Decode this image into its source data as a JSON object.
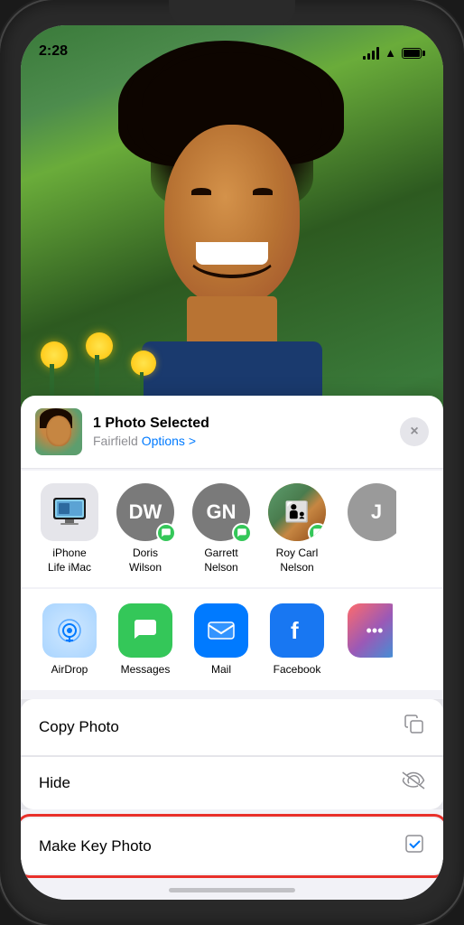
{
  "status": {
    "time": "2:28",
    "location_active": true
  },
  "header": {
    "photo_count": "1 Photo Selected",
    "location": "Fairfield",
    "options_label": "Options >",
    "close_btn": "×"
  },
  "contacts": [
    {
      "id": "imac",
      "name": "iPhone\nLife iMac",
      "type": "device",
      "initials": ""
    },
    {
      "id": "doris",
      "name": "Doris\nWilson",
      "type": "person",
      "initials": "DW",
      "color": "#8e8e93"
    },
    {
      "id": "garrett",
      "name": "Garrett\nNelson",
      "type": "person",
      "initials": "GN",
      "color": "#8e8e93"
    },
    {
      "id": "roy",
      "name": "Roy Carl\nNelson",
      "type": "person_photo",
      "initials": "",
      "color": ""
    },
    {
      "id": "more",
      "name": "...",
      "type": "more",
      "initials": "J",
      "color": "#8e8e93"
    }
  ],
  "apps": [
    {
      "id": "airdrop",
      "name": "AirDrop",
      "icon_type": "airdrop"
    },
    {
      "id": "messages",
      "name": "Messages",
      "icon_type": "messages"
    },
    {
      "id": "mail",
      "name": "Mail",
      "icon_type": "mail"
    },
    {
      "id": "facebook",
      "name": "Facebook",
      "icon_type": "facebook"
    },
    {
      "id": "more",
      "name": "More",
      "icon_type": "more"
    }
  ],
  "actions": [
    {
      "id": "copy",
      "label": "Copy Photo",
      "icon": "copy"
    },
    {
      "id": "hide",
      "label": "Hide",
      "icon": "eye_slash"
    }
  ],
  "make_key_photo": {
    "label": "Make Key Photo",
    "icon": "checkbox",
    "highlighted": true
  }
}
